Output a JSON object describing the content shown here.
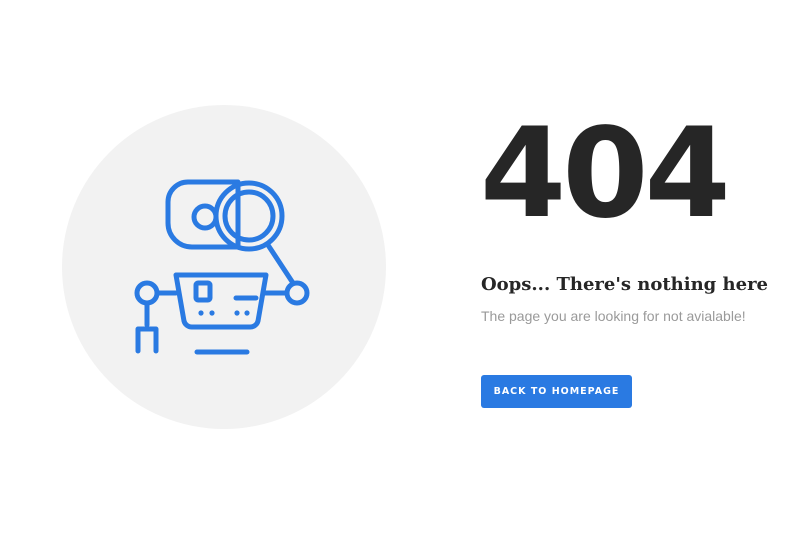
{
  "error": {
    "code": "404",
    "headline": "Oops... There's nothing here",
    "message": "The page you are looking for not avialable!"
  },
  "actions": {
    "back_label": "BACK TO HOMEPAGE"
  },
  "illustration": {
    "icon": "robot-icon",
    "accent_color": "#2a7ae2",
    "background_color": "#f2f2f2"
  }
}
